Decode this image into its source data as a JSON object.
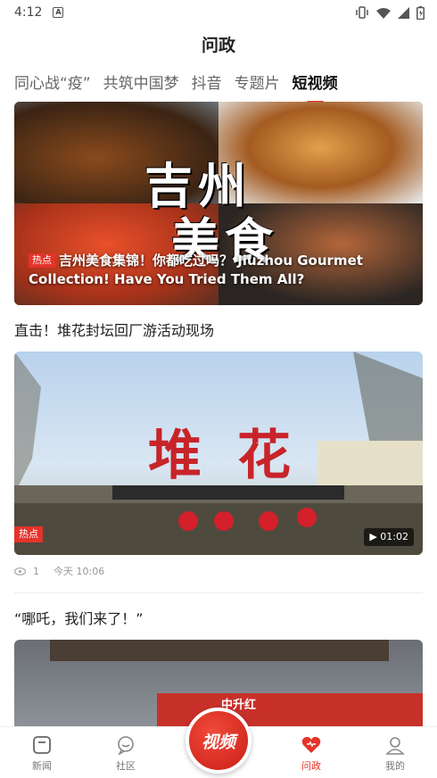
{
  "status": {
    "time": "4:12"
  },
  "header": {
    "title": "问政"
  },
  "tabs": [
    {
      "label": "同心战“疫”"
    },
    {
      "label": "共筑中国梦"
    },
    {
      "label": "抖音"
    },
    {
      "label": "专题片"
    },
    {
      "label": "短视频"
    }
  ],
  "active_tab": "短视频",
  "feed": {
    "item1": {
      "badge": "热点",
      "title": "吉州美食集锦！你都吃过吗？ Jiuzhou Gourmet Collection! Have You Tried Them All?",
      "overlay_line1": "吉州",
      "overlay_line2": "美食"
    },
    "item2": {
      "title": "直击！堆花封坛回厂游活动现场",
      "badge": "热点",
      "duration": "01:02",
      "views": "1",
      "time": "今天 10:06",
      "sign_text": "堆花"
    },
    "item3": {
      "title": "“哪吒，我们来了！”",
      "sign_text": "中升红"
    }
  },
  "bottom_nav": {
    "items": [
      {
        "label": "新闻"
      },
      {
        "label": "社区"
      },
      {
        "label": "问政"
      },
      {
        "label": "我的"
      }
    ],
    "center_label": "视频",
    "active": "问政"
  },
  "colors": {
    "accent": "#e5332a"
  }
}
